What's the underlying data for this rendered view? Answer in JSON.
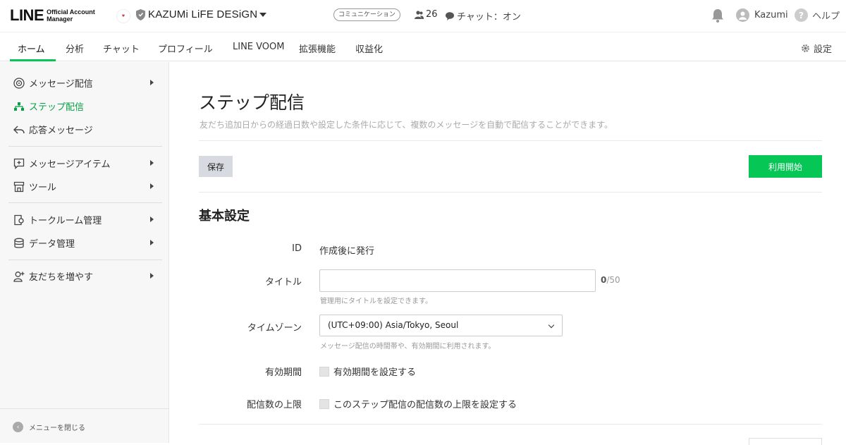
{
  "header": {
    "logo_main": "LINE",
    "logo_sub_line1": "Official Account",
    "logo_sub_line2": "Manager",
    "account_name": "KAZUMi LiFE DESiGN",
    "communication_badge": "コミュニケーション",
    "friend_count": "26",
    "chat_status": "チャット：オン",
    "user_name": "Kazumi",
    "help_label": "ヘルプ"
  },
  "tabs": [
    {
      "label": "ホーム"
    },
    {
      "label": "分析"
    },
    {
      "label": "チャット"
    },
    {
      "label": "プロフィール"
    },
    {
      "label": "LINE VOOM"
    },
    {
      "label": "拡張機能"
    },
    {
      "label": "収益化"
    }
  ],
  "settings_label": "設定",
  "sidebar": {
    "items": [
      {
        "label": "メッセージ配信",
        "icon": "broadcast-icon"
      },
      {
        "label": "ステップ配信",
        "icon": "step-tree-icon"
      },
      {
        "label": "応答メッセージ",
        "icon": "reply-arrow-icon"
      },
      {
        "label": "メッセージアイテム",
        "icon": "message-plus-icon"
      },
      {
        "label": "ツール",
        "icon": "store-icon"
      },
      {
        "label": "トークルーム管理",
        "icon": "talkroom-icon"
      },
      {
        "label": "データ管理",
        "icon": "database-icon"
      },
      {
        "label": "友だちを増やす",
        "icon": "add-user-icon"
      }
    ],
    "close_menu": "メニューを閉じる"
  },
  "main": {
    "title": "ステップ配信",
    "description": "友だち追加日からの経過日数や設定した条件に応じて、複数のメッセージを自動で配信することができます。",
    "save_label": "保存",
    "start_label": "利用開始",
    "section_title": "基本設定",
    "fields": {
      "id_label": "ID",
      "id_value": "作成後に発行",
      "title_label": "タイトル",
      "title_value": "",
      "title_count": "0",
      "title_max": "/50",
      "title_hint": "管理用にタイトルを設定できます。",
      "timezone_label": "タイムゾーン",
      "timezone_value": "(UTC+09:00) Asia/Tokyo, Seoul",
      "timezone_hint": "メッセージ配信の時間帯や、有効期間に利用されます。",
      "validity_label": "有効期間",
      "validity_checkbox": "有効期間を設定する",
      "limit_label": "配信数の上限",
      "limit_checkbox": "このステップ配信の配信数の上限を設定する"
    }
  },
  "colors": {
    "accent_green": "#06c755",
    "active_sidebar_text": "#06a345"
  }
}
